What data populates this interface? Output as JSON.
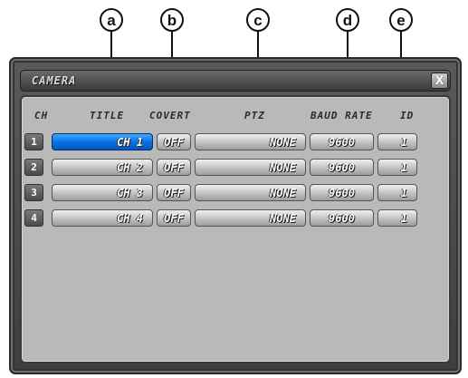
{
  "callouts": [
    "a",
    "b",
    "c",
    "d",
    "e"
  ],
  "window": {
    "title": "CAMERA",
    "close_label": "X"
  },
  "columns": {
    "ch": "CH",
    "title": "TITLE",
    "covert": "COVERT",
    "ptz": "PTZ",
    "baud_rate": "BAUD RATE",
    "id": "ID"
  },
  "rows": [
    {
      "ch": "1",
      "title": "CH 1",
      "covert": "OFF",
      "ptz": "NONE",
      "baud": "9600",
      "id": "1",
      "selected": true
    },
    {
      "ch": "2",
      "title": "CH 2",
      "covert": "OFF",
      "ptz": "NONE",
      "baud": "9600",
      "id": "1",
      "selected": false
    },
    {
      "ch": "3",
      "title": "CH 3",
      "covert": "OFF",
      "ptz": "NONE",
      "baud": "9600",
      "id": "1",
      "selected": false
    },
    {
      "ch": "4",
      "title": "CH 4",
      "covert": "OFF",
      "ptz": "NONE",
      "baud": "9600",
      "id": "1",
      "selected": false
    }
  ],
  "colors": {
    "selected": "#0a73e6",
    "panel": "#b9b9b9",
    "window": "#4a4a4a"
  }
}
